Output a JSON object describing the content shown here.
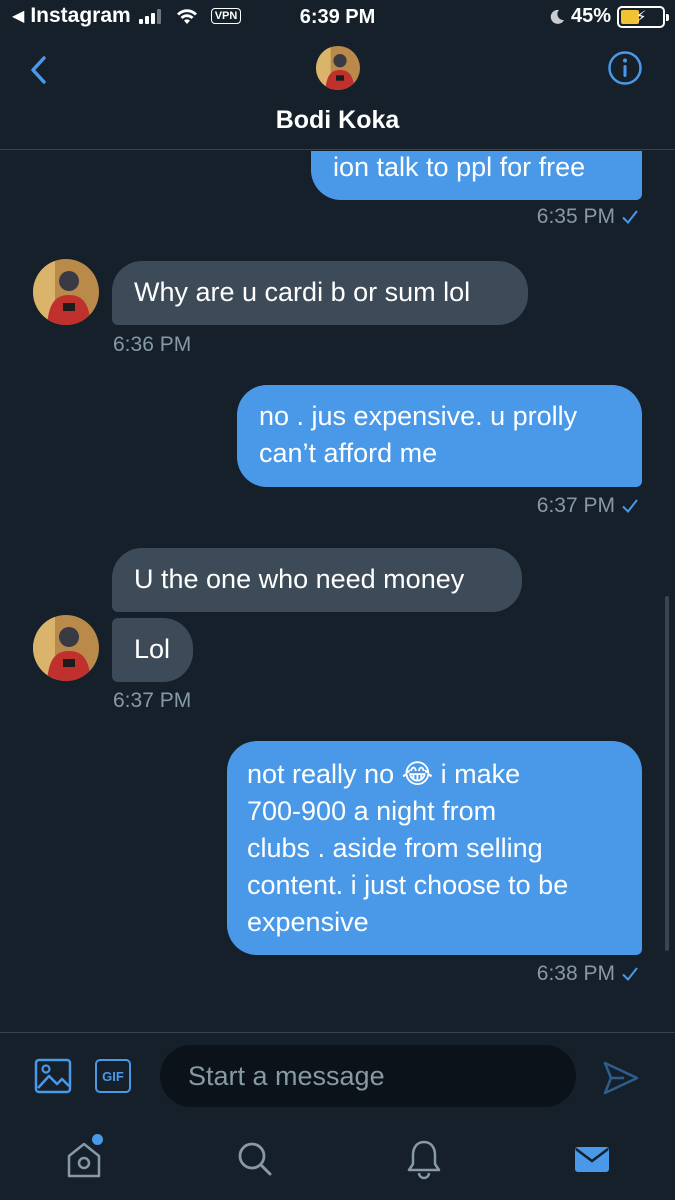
{
  "status_bar": {
    "back_app": "Instagram",
    "vpn": "VPN",
    "time": "6:39 PM",
    "battery": "45%",
    "battery_level": 0.45
  },
  "header": {
    "name": "Bodi Koka",
    "back_icon": "chevron-left-icon",
    "info_icon": "info-icon"
  },
  "messages": [
    {
      "direction": "out",
      "lines": [
        "ion talk to ppl for free"
      ],
      "time": "6:35 PM",
      "read": true
    },
    {
      "direction": "in",
      "lines": [
        "Why are u cardi b or sum lol"
      ],
      "time": "6:36 PM"
    },
    {
      "direction": "out",
      "lines": [
        "no . jus expensive. u prolly",
        "can’t afford me"
      ],
      "time": "6:37 PM",
      "read": true
    },
    {
      "direction": "in",
      "lines": [
        "U the one who need money"
      ]
    },
    {
      "direction": "in",
      "lines": [
        "Lol"
      ],
      "time": "6:37 PM"
    },
    {
      "direction": "out",
      "lines": [
        "not really no 😂 i make",
        "700-900 a night from",
        "clubs . aside from selling",
        "content. i just choose to be",
        "expensive"
      ],
      "time": "6:38 PM",
      "read": true
    }
  ],
  "composer": {
    "placeholder": "Start a message",
    "gif_label": "GIF"
  },
  "tabs": [
    {
      "name": "home",
      "icon": "home-icon",
      "has_notification": true
    },
    {
      "name": "search",
      "icon": "search-icon"
    },
    {
      "name": "notifications",
      "icon": "bell-icon"
    },
    {
      "name": "messages",
      "icon": "envelope-icon",
      "active": true
    }
  ],
  "colors": {
    "background": "#15202b",
    "accent": "#4a99e9",
    "incoming_bubble": "#3d4b59",
    "muted_text": "#8899a6"
  }
}
